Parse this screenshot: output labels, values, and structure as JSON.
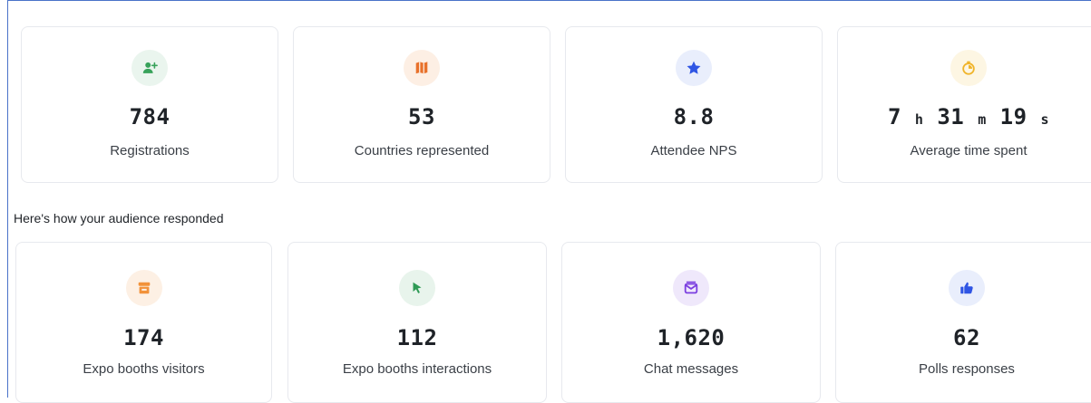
{
  "top_cards": [
    {
      "value": "784",
      "label": "Registrations",
      "icon": "user-plus-icon",
      "icon_color": "#37a25a",
      "icon_bg": "#eaf5ee"
    },
    {
      "value": "53",
      "label": "Countries represented",
      "icon": "map-icon",
      "icon_color": "#e8712b",
      "icon_bg": "#fdefe4"
    },
    {
      "value": "8.8",
      "label": "Attendee NPS",
      "icon": "star-icon",
      "icon_color": "#2f55e4",
      "icon_bg": "#e9eefc"
    },
    {
      "value_parts": {
        "hours": "7",
        "h": "h",
        "minutes": "31",
        "m": "m",
        "seconds": "19",
        "s": "s"
      },
      "label": "Average time spent",
      "icon": "stopwatch-icon",
      "icon_color": "#f0b429",
      "icon_bg": "#fdf6e3"
    }
  ],
  "section": {
    "title": "Here's how your audience responded"
  },
  "bottom_cards": [
    {
      "value": "174",
      "label": "Expo booths visitors",
      "icon": "booth-icon",
      "icon_color": "#f2923a",
      "icon_bg": "#fdf0e4"
    },
    {
      "value": "112",
      "label": "Expo booths interactions",
      "icon": "cursor-icon",
      "icon_color": "#2e9a55",
      "icon_bg": "#e8f4ec"
    },
    {
      "value": "1,620",
      "label": "Chat messages",
      "icon": "message-icon",
      "icon_color": "#7b3fe0",
      "icon_bg": "#efe8fb"
    },
    {
      "value": "62",
      "label": "Polls responses",
      "icon": "thumbs-up-icon",
      "icon_color": "#2f55e4",
      "icon_bg": "#e9eefc"
    }
  ]
}
